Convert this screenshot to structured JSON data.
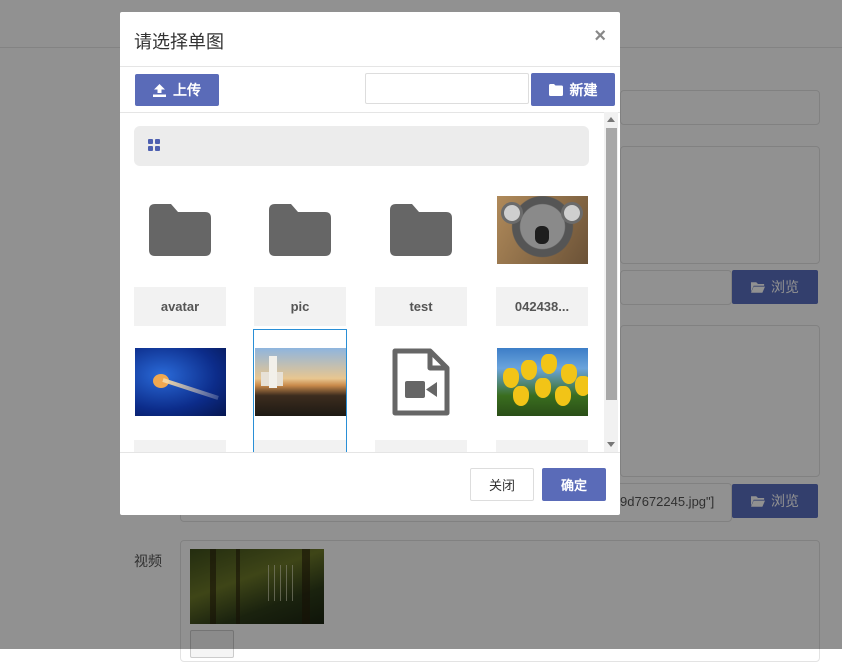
{
  "background": {
    "browse_label": "浏览",
    "video_label": "视频",
    "path_snippet": "9d7672245.jpg\"]"
  },
  "modal": {
    "title": "请选择单图",
    "close_symbol": "×",
    "upload_label": "上传",
    "new_label": "新建",
    "new_folder_input": {
      "value": "",
      "placeholder": ""
    },
    "footer": {
      "close_label": "关闭",
      "ok_label": "确定"
    }
  },
  "files": [
    {
      "name": "avatar",
      "kind": "folder"
    },
    {
      "name": "pic",
      "kind": "folder"
    },
    {
      "name": "test",
      "kind": "folder"
    },
    {
      "name": "042438...",
      "kind": "image",
      "subject": "koala"
    },
    {
      "name": "",
      "kind": "image",
      "subject": "jellyfish"
    },
    {
      "name": "",
      "kind": "image",
      "subject": "lighthouse",
      "selected": true
    },
    {
      "name": "",
      "kind": "video-file"
    },
    {
      "name": "",
      "kind": "image",
      "subject": "tulips"
    }
  ],
  "colors": {
    "primary": "#5a6bb8",
    "selection": "#2a8fd6",
    "folder": "#666666",
    "overlay": "rgba(0,0,0,0.43)"
  }
}
